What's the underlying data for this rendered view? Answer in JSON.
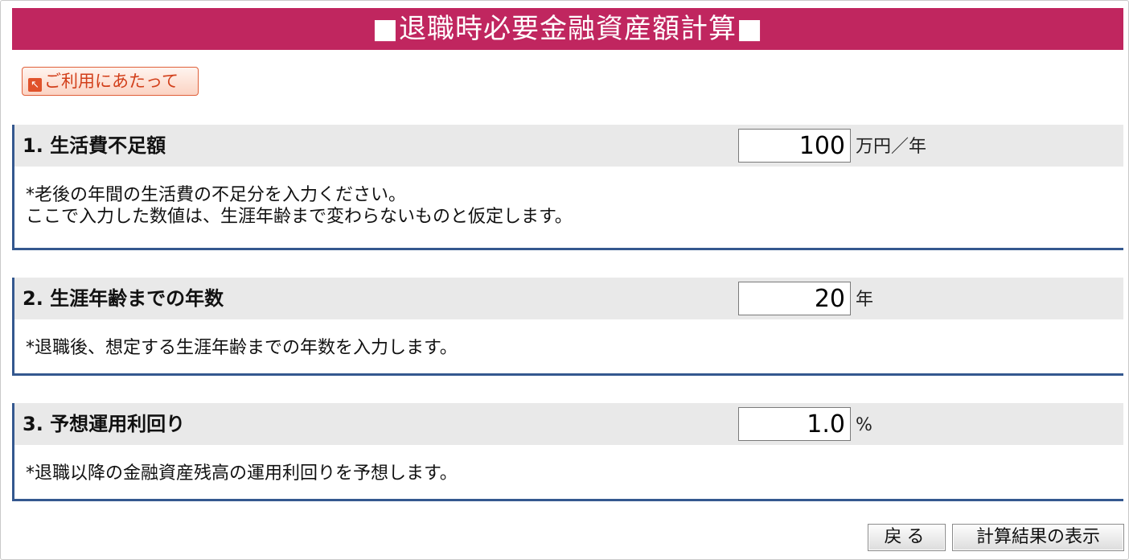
{
  "header": {
    "title": "■退職時必要金融資産額計算■"
  },
  "usage_button": {
    "icon": "external-link-icon",
    "label": "ご利用にあたって"
  },
  "sections": [
    {
      "label": "1. 生活費不足額",
      "value": "100",
      "unit": "万円／年",
      "notes": [
        "*老後の年間の生活費の不足分を入力ください。",
        "ここで入力した数値は、生涯年齢まで変わらないものと仮定します。"
      ]
    },
    {
      "label": "2. 生涯年齢までの年数",
      "value": "20",
      "unit": "年",
      "notes": [
        "*退職後、想定する生涯年齢までの年数を入力します。"
      ]
    },
    {
      "label": "3. 予想運用利回り",
      "value": "1.0",
      "unit": "%",
      "notes": [
        "*退職以降の金融資産残高の運用利回りを予想します。"
      ]
    }
  ],
  "buttons": {
    "back": "戻る",
    "show_result": "計算結果の表示"
  },
  "colors": {
    "title_bg": "#c0265f",
    "section_border": "#34588f",
    "section_head_bg": "#e9e9e9",
    "usage_accent": "#e0522b"
  }
}
